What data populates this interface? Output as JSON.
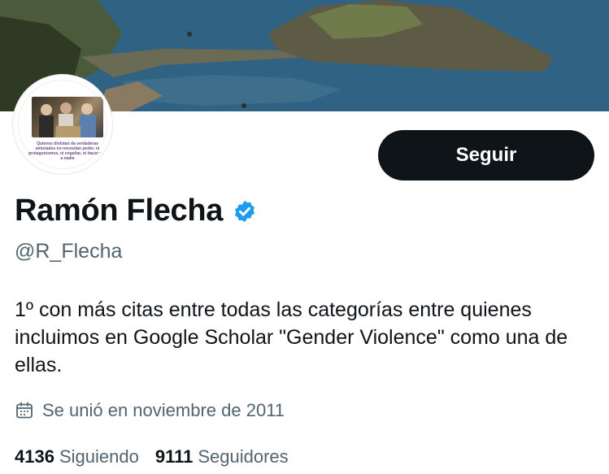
{
  "profile": {
    "display_name": "Ramón Flecha",
    "handle": "@R_Flecha",
    "bio": "1º con más citas entre todas las categorías entre quienes incluimos en Google Scholar \"Gender Violence\" como una de ellas.",
    "joined": "Se unió en noviembre de 2011",
    "avatar_caption": "Quienes disfutan da verdaderas amistades no necesitan poder, ni protagonismos, ni engañar, ni hacer mal a nadie",
    "verified_icon": "verified-badge-icon",
    "verified_color": "#1d9bf0"
  },
  "actions": {
    "follow_label": "Seguir"
  },
  "stats": {
    "following_count": "4136",
    "following_label": "Siguiendo",
    "followers_count": "9111",
    "followers_label": "Seguidores"
  },
  "colors": {
    "text_primary": "#0f1419",
    "text_secondary": "#536471",
    "button_bg": "#0f1419",
    "button_text": "#ffffff"
  }
}
